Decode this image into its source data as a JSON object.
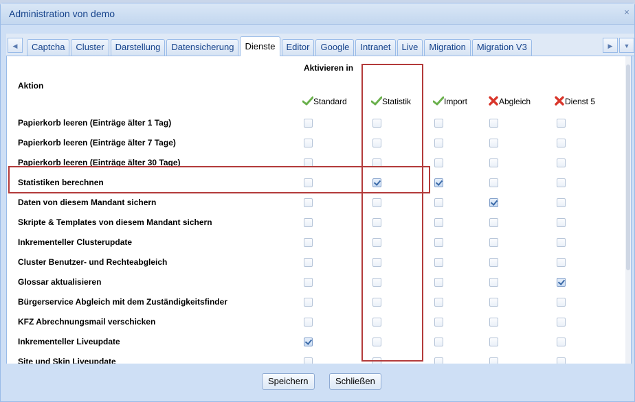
{
  "window": {
    "title": "Administration von demo",
    "close_glyph": "×"
  },
  "tabs": [
    "Captcha",
    "Cluster",
    "Darstellung",
    "Datensicherung",
    "Dienste",
    "Editor",
    "Google",
    "Intranet",
    "Live",
    "Migration",
    "Migration V3"
  ],
  "active_tab": "Dienste",
  "headers": {
    "aktion": "Aktion",
    "aktivieren_in": "Aktivieren in"
  },
  "columns": [
    {
      "label": "Standard",
      "status": "enabled",
      "icon": "check-icon",
      "color": "#6ab04c"
    },
    {
      "label": "Statistik",
      "status": "enabled",
      "icon": "check-icon",
      "color": "#6ab04c"
    },
    {
      "label": "Import",
      "status": "enabled",
      "icon": "check-icon",
      "color": "#6ab04c"
    },
    {
      "label": "Abgleich",
      "status": "disabled",
      "icon": "cross-icon",
      "color": "#d9362b"
    },
    {
      "label": "Dienst 5",
      "status": "disabled",
      "icon": "cross-icon",
      "color": "#d9362b"
    }
  ],
  "rows": [
    {
      "label": "Papierkorb leeren (Einträge älter 1 Tag)",
      "checked": [
        false,
        false,
        false,
        false,
        false
      ]
    },
    {
      "label": "Papierkorb leeren (Einträge älter 7 Tage)",
      "checked": [
        false,
        false,
        false,
        false,
        false
      ]
    },
    {
      "label": "Papierkorb leeren (Einträge älter 30 Tage)",
      "checked": [
        false,
        false,
        false,
        false,
        false
      ]
    },
    {
      "label": "Statistiken berechnen",
      "checked": [
        false,
        true,
        true,
        false,
        false
      ]
    },
    {
      "label": "Daten von diesem Mandant sichern",
      "checked": [
        false,
        false,
        false,
        true,
        false
      ]
    },
    {
      "label": "Skripte & Templates von diesem Mandant sichern",
      "checked": [
        false,
        false,
        false,
        false,
        false
      ]
    },
    {
      "label": "Inkrementeller Clusterupdate",
      "checked": [
        false,
        false,
        false,
        false,
        false
      ]
    },
    {
      "label": "Cluster Benutzer- und Rechteabgleich",
      "checked": [
        false,
        false,
        false,
        false,
        false
      ]
    },
    {
      "label": "Glossar aktualisieren",
      "checked": [
        false,
        false,
        false,
        false,
        true
      ]
    },
    {
      "label": "Bürgerservice Abgleich mit dem Zuständigkeitsfinder",
      "checked": [
        false,
        false,
        false,
        false,
        false
      ]
    },
    {
      "label": "KFZ Abrechnungsmail verschicken",
      "checked": [
        false,
        false,
        false,
        false,
        false
      ]
    },
    {
      "label": "Inkrementeller Liveupdate",
      "checked": [
        true,
        false,
        false,
        false,
        false
      ]
    },
    {
      "label": "Site und Skin Liveupdate",
      "checked": [
        false,
        false,
        false,
        false,
        false
      ]
    }
  ],
  "buttons": {
    "save": "Speichern",
    "close": "Schließen"
  },
  "highlight_color": "#b33a3a"
}
